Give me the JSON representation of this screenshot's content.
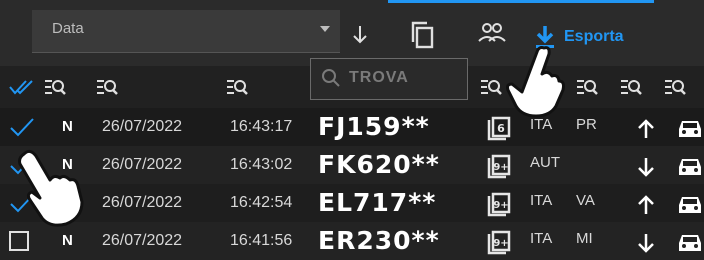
{
  "toolbar": {
    "select_value": "Data",
    "export_label": "Esporta"
  },
  "search": {
    "placeholder": "TROVA"
  },
  "colors": {
    "accent": "#2196f3",
    "background": "#1e1e1e"
  },
  "icons": [
    "filter-search-icon",
    "copy-icon",
    "people-icon",
    "download-icon",
    "sort-down-icon",
    "check-icon",
    "checkbox-icon",
    "vehicle-class-icon",
    "arrow-up-icon",
    "arrow-down-icon",
    "car-icon",
    "hand-pointer-icon"
  ],
  "rows": [
    {
      "checked": true,
      "flag": "N",
      "date": "26/07/2022",
      "time": "16:43:17",
      "plate": "FJ159**",
      "class": "6",
      "country": "ITA",
      "province": "PR",
      "direction": "up"
    },
    {
      "checked": true,
      "flag": "N",
      "date": "26/07/2022",
      "time": "16:43:02",
      "plate": "FK620**",
      "class": "9+",
      "country": "AUT",
      "province": "",
      "direction": "down"
    },
    {
      "checked": true,
      "flag": "N",
      "date": "26/07/2022",
      "time": "16:42:54",
      "plate": "EL717**",
      "class": "9+",
      "country": "ITA",
      "province": "VA",
      "direction": "up"
    },
    {
      "checked": false,
      "flag": "N",
      "date": "26/07/2022",
      "time": "16:41:56",
      "plate": "ER230**",
      "class": "9+",
      "country": "ITA",
      "province": "MI",
      "direction": "down"
    }
  ]
}
